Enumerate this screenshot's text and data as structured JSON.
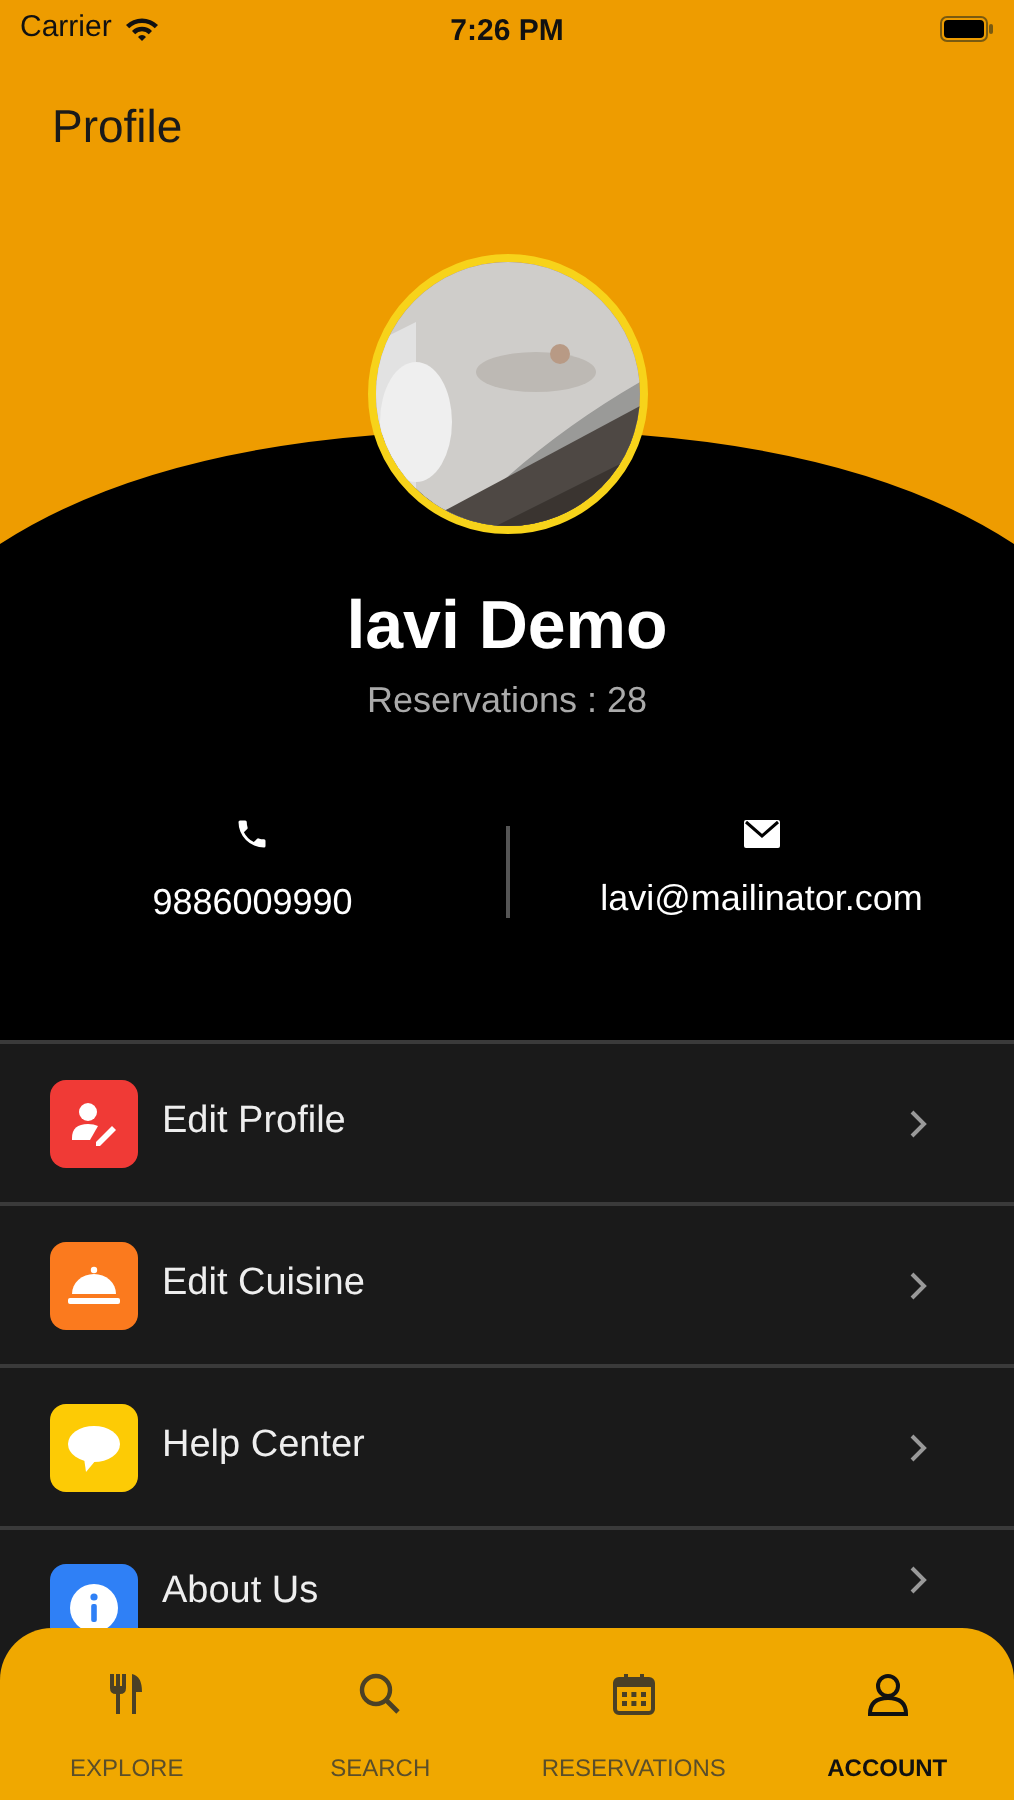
{
  "status_bar": {
    "carrier": "Carrier",
    "time": "7:26 PM"
  },
  "header": {
    "title": "Profile"
  },
  "profile": {
    "name": "lavi Demo",
    "reservations": "Reservations : 28",
    "phone": "9886009990",
    "email": "lavi@mailinator.com"
  },
  "menu": [
    {
      "label": "Edit Profile",
      "color": "#f03a36"
    },
    {
      "label": "Edit Cuisine",
      "color": "#fb7a1e"
    },
    {
      "label": "Help Center",
      "color": "#fdcb05"
    },
    {
      "label": "About Us",
      "color": "#2f80f6"
    }
  ],
  "tabs": [
    {
      "label": "EXPLORE",
      "selected": false
    },
    {
      "label": "SEARCH",
      "selected": false
    },
    {
      "label": "RESERVATIONS",
      "selected": false
    },
    {
      "label": "ACCOUNT",
      "selected": true
    }
  ]
}
